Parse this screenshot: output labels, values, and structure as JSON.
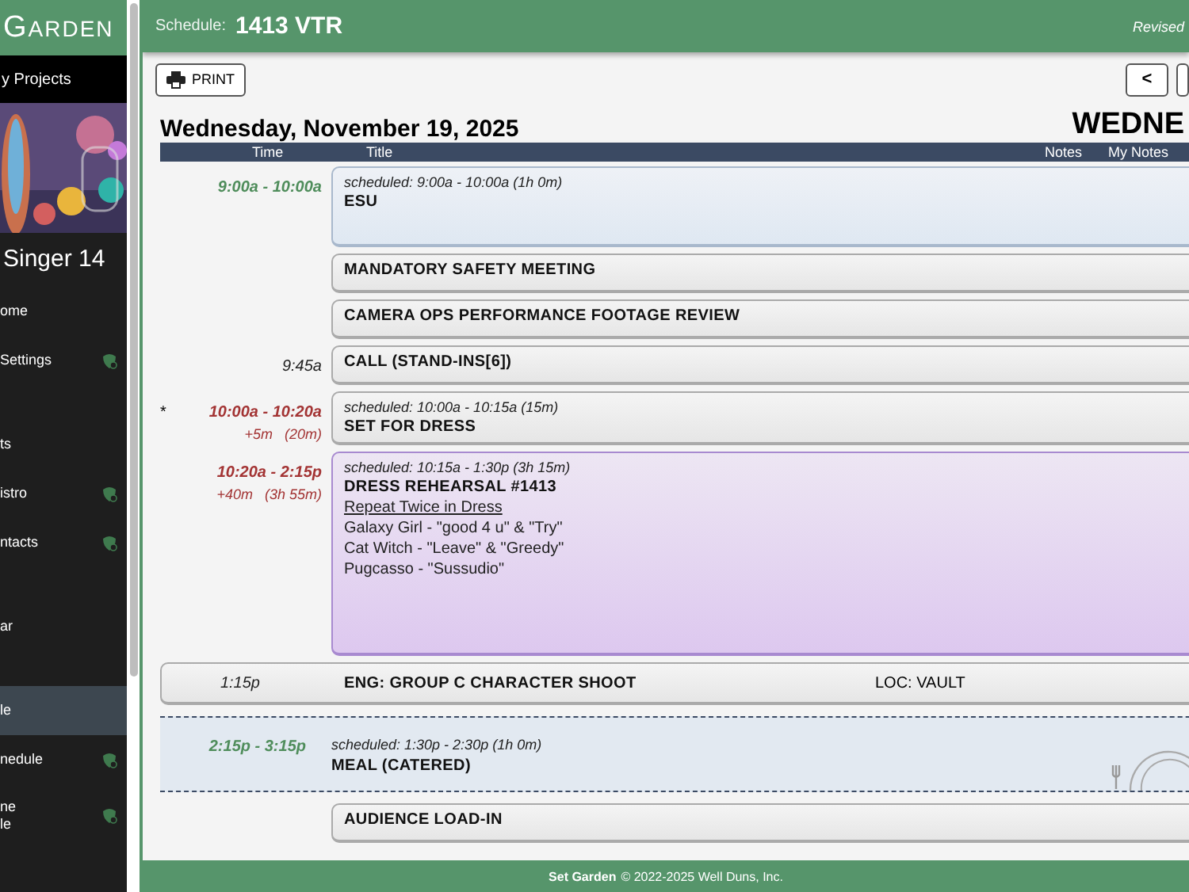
{
  "sidebar": {
    "logo": "GARDEN",
    "projects_link": "y Projects",
    "project_title": "Singer 14",
    "groups": [
      [
        {
          "label": "ome",
          "icon": false,
          "selected": false
        },
        {
          "label": "Settings",
          "icon": true,
          "selected": false
        }
      ],
      [
        {
          "label": "ts",
          "icon": false,
          "selected": false
        },
        {
          "label": "istro",
          "icon": true,
          "selected": false
        },
        {
          "label": "ntacts",
          "icon": true,
          "selected": false
        }
      ],
      [
        {
          "label": "ar",
          "icon": false,
          "selected": false
        }
      ],
      [
        {
          "label": "le",
          "icon": false,
          "selected": true
        },
        {
          "label": "nedule",
          "icon": true,
          "selected": false
        },
        {
          "label": "ne\nle",
          "icon": true,
          "selected": false
        }
      ]
    ]
  },
  "header": {
    "label": "Schedule:",
    "title": "1413 VTR",
    "revised": "Revised"
  },
  "toolbar": {
    "print": "PRINT",
    "prev": "<"
  },
  "date": "Wednesday, November 19, 2025",
  "day_banner": "WEDNE",
  "table": {
    "columns": [
      "Time",
      "Title",
      "Notes",
      "My Notes"
    ],
    "rows": [
      {
        "kind": "info",
        "time": "9:00a - 10:00a",
        "late": false,
        "scheduled": "scheduled: 9:00a - 10:00a (1h 0m)",
        "title": "ESU"
      },
      {
        "kind": "card",
        "title": "MANDATORY SAFETY MEETING"
      },
      {
        "kind": "card",
        "title": "CAMERA OPS PERFORMANCE FOOTAGE REVIEW"
      },
      {
        "kind": "card",
        "time": "9:45a",
        "title": "CALL (STAND-INS[6])"
      },
      {
        "kind": "card",
        "marker": "*",
        "time": "10:00a - 10:20a",
        "late": true,
        "delta": "+5m",
        "duration": "(20m)",
        "scheduled": "scheduled: 10:00a - 10:15a (15m)",
        "title": "SET FOR DRESS"
      },
      {
        "kind": "rehearsal",
        "time": "10:20a - 2:15p",
        "late": true,
        "delta": "+40m",
        "duration": "(3h 55m)",
        "scheduled": "scheduled: 10:15a - 1:30p (3h 15m)",
        "title": "DRESS REHEARSAL #1413",
        "subtitle": "Repeat Twice in Dress",
        "lines": [
          "Galaxy Girl - \"good 4 u\" & \"Try\"",
          "Cat Witch - \"Leave\" & \"Greedy\"",
          "Pugcasso - \"Sussudio\""
        ]
      },
      {
        "kind": "wide",
        "time": "1:15p",
        "title": "ENG: GROUP C CHARACTER SHOOT",
        "notes": "LOC: VAULT"
      },
      {
        "kind": "meal",
        "time": "2:15p - 3:15p",
        "late": false,
        "scheduled": "scheduled: 1:30p - 2:30p (1h 0m)",
        "title": "MEAL (CATERED)"
      },
      {
        "kind": "card",
        "title": "AUDIENCE LOAD-IN"
      }
    ]
  },
  "footer": {
    "brand": "Set Garden",
    "text": "© 2022-2025 Well Duns, Inc."
  }
}
